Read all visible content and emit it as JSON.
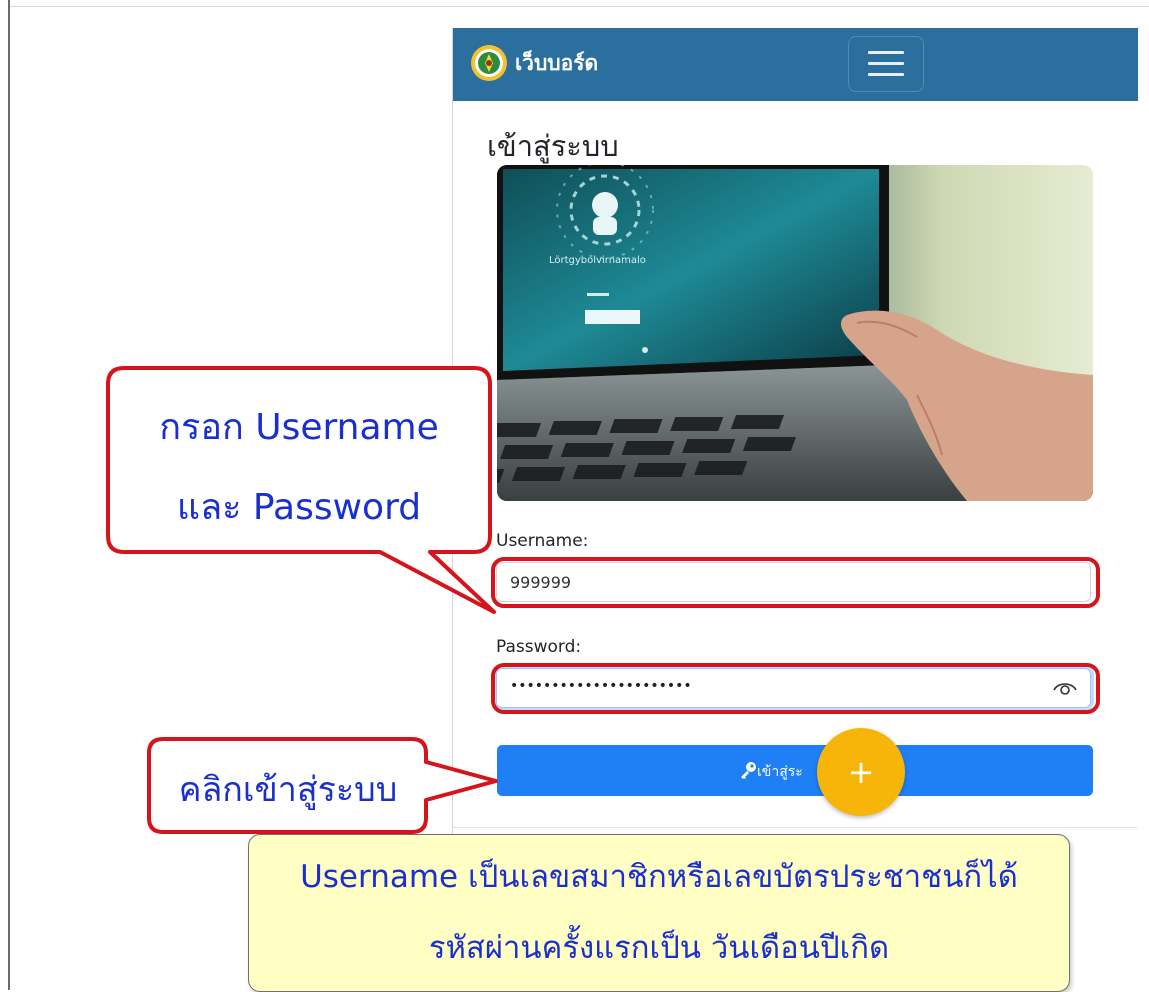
{
  "navbar": {
    "brand": "เว็บบอร์ด"
  },
  "page": {
    "title": "เข้าสู่ระบบ"
  },
  "hero": {
    "screen_text": "Lörtgybolvirnamalo"
  },
  "form": {
    "username_label": "Username:",
    "username_value": "999999",
    "password_label": "Password:",
    "password_masked": "••••••••••••••••••••••",
    "submit_label": "เข้าสู่ระ"
  },
  "fab": {
    "label": "+"
  },
  "callouts": {
    "username_hint_line1": "กรอก Username",
    "username_hint_line2": "และ Password",
    "login_hint": "คลิกเข้าสู่ระบบ"
  },
  "info": {
    "line1": "Username เป็นเลขสมาชิกหรือเลขบัตรประชาชนก็ได้",
    "line2": "รหัสผ่านครั้งแรกเป็น วันเดือนปีเกิด"
  },
  "colors": {
    "navbar": "#2b6f9e",
    "primary_button": "#1f80f6",
    "fab": "#f6b508",
    "callout_border": "#d6141c",
    "callout_text": "#1a2fd1",
    "info_background": "#ffffc3"
  },
  "icons": [
    "logo-emblem-icon",
    "hamburger-menu-icon",
    "eye-icon",
    "key-icon",
    "plus-icon"
  ]
}
